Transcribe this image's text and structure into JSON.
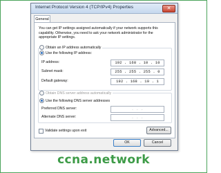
{
  "window": {
    "title": "Internet Protocol Version 4 (TCP/IPv4) Properties",
    "close_label": "✕"
  },
  "tabs": [
    {
      "label": "General"
    }
  ],
  "description": "You can get IP settings assigned automatically if your network supports this capability. Otherwise, you need to ask your network administrator for the appropriate IP settings.",
  "ip": {
    "auto_label": "Obtain an IP address automatically",
    "manual_label": "Use the following IP address:",
    "fields": [
      {
        "label": "IP address:",
        "value": "192 . 168 . 10 . 10"
      },
      {
        "label": "Subnet mask:",
        "value": "255 . 255 . 255 . 0"
      },
      {
        "label": "Default gateway:",
        "value": "192 . 168 . 10 . 1"
      }
    ]
  },
  "dns": {
    "auto_label": "Obtain DNS server address automatically",
    "manual_label": "Use the following DNS server addresses",
    "fields": [
      {
        "label": "Preferred DNS server:",
        "value": ".   .   ."
      },
      {
        "label": "Alternate DNS server:",
        "value": ".   .   ."
      }
    ]
  },
  "validate_label": "Validate settings upon exit",
  "buttons": {
    "advanced": "Advanced...",
    "ok": "OK",
    "cancel": "Cancel"
  },
  "watermark": "ccna.network",
  "colors": {
    "accent_radio": "#2b6fc0",
    "watermark_green": "#3d9b47",
    "close_red": "#c9442f"
  }
}
